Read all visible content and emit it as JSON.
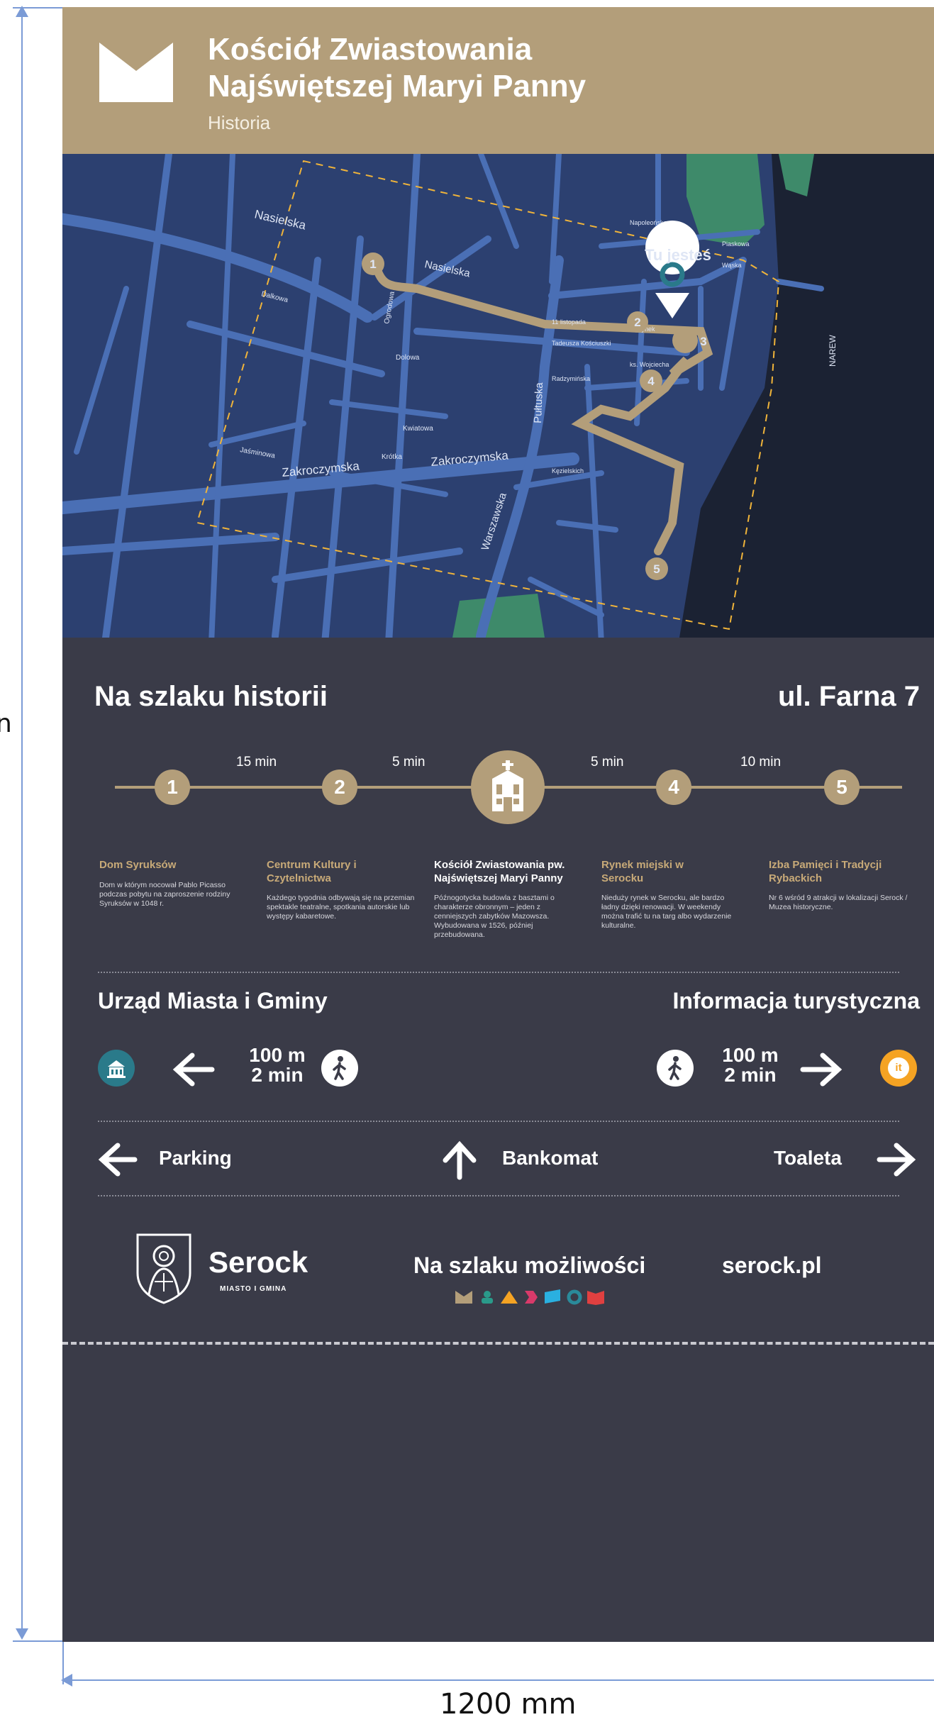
{
  "header": {
    "title_line1": "Kościół Zwiastowania",
    "title_line2": "Najświętszej Maryi Panny",
    "subtitle": "Historia"
  },
  "map": {
    "you_are_here": "Tu jesteś",
    "streets": {
      "nasielska": "Nasielska",
      "nasielska2": "Nasielska",
      "zakroczymska": "Zakroczymska",
      "zakroczymska2": "Zakroczymska",
      "pultuska": "Pułtuska",
      "warszawska": "Warszawska",
      "dalkowa": "Dalkowa",
      "dolowa": "Dolowa",
      "kwiatowa": "Kwiatowa",
      "krotka": "Krótka",
      "jasminowa": "Jaśminowa",
      "ogrodowa": "Ogrodowa",
      "listopada": "11 listopada",
      "kosciuszki": "Tadeusza Kościuszki",
      "rynek": "Rynek",
      "radzyminska": "Radzymińska",
      "wojciecha": "ks. Wojciecha",
      "kozielskich": "Kęzielskich",
      "napoleonska": "Napoleońska",
      "piaskowa": "Piaskowa",
      "wjska": "Wąska",
      "narew": "NAREW"
    },
    "route_points": [
      "1",
      "2",
      "3",
      "4",
      "5"
    ]
  },
  "trail": {
    "title": "Na szlaku historii",
    "address": "ul. Farna 7",
    "times": [
      "15 min",
      "5 min",
      "5 min",
      "10 min"
    ],
    "nodes": [
      "1",
      "2",
      "4",
      "5"
    ],
    "stops": [
      {
        "title": "Dom Syruksów",
        "desc": "Dom w którym nocował Pablo Picasso podczas pobytu na zaproszenie rodziny Syruksów w 1048 r."
      },
      {
        "title": "Centrum Kultury i Czytelnictwa",
        "desc": "Każdego tygodnia odbywają się na przemian spektakle teatralne, spotkania autorskie lub występy kabaretowe."
      },
      {
        "title": "Kościół Zwiastowania pw. Najświętszej Maryi Panny",
        "desc": "Późnogotycka budowla z basztami o charakterze obronnym – jeden z cenniejszych zabytków Mazowsza. Wybudowana w 1526, później przebudowana."
      },
      {
        "title": "Rynek miejski w Serocku",
        "desc": "Nieduży rynek w Serocku, ale bardzo ładny dzięki renowacji. W weekendy można trafić tu na targ albo wydarzenie kulturalne."
      },
      {
        "title": "Izba Pamięci i Tradycji Rybackich",
        "desc": "Nr 6 wśród 9 atrakcji w lokalizacji Serock / Muzea historyczne."
      }
    ]
  },
  "directions": {
    "urzad": {
      "title": "Urząd Miasta i Gminy",
      "distance": "100 m",
      "time": "2 min"
    },
    "info": {
      "title": "Informacja turystyczna",
      "distance": "100 m",
      "time": "2 min",
      "badge": "it"
    }
  },
  "nav": {
    "parking": "Parking",
    "bankomat": "Bankomat",
    "toaleta": "Toaleta"
  },
  "footer": {
    "brand": "Serock",
    "brand_sub": "MIASTO I GMINA",
    "slogan": "Na szlaku możliwości",
    "website": "serock.pl"
  },
  "dimensions": {
    "height_label": "n",
    "width_label": "1200 mm"
  },
  "colors": {
    "gold": "#b39e7a",
    "panel": "#3a3b48",
    "map_bg": "#2c4070",
    "street": "#4a6fb5",
    "teal": "#2a7a8a",
    "orange": "#f5a323"
  }
}
